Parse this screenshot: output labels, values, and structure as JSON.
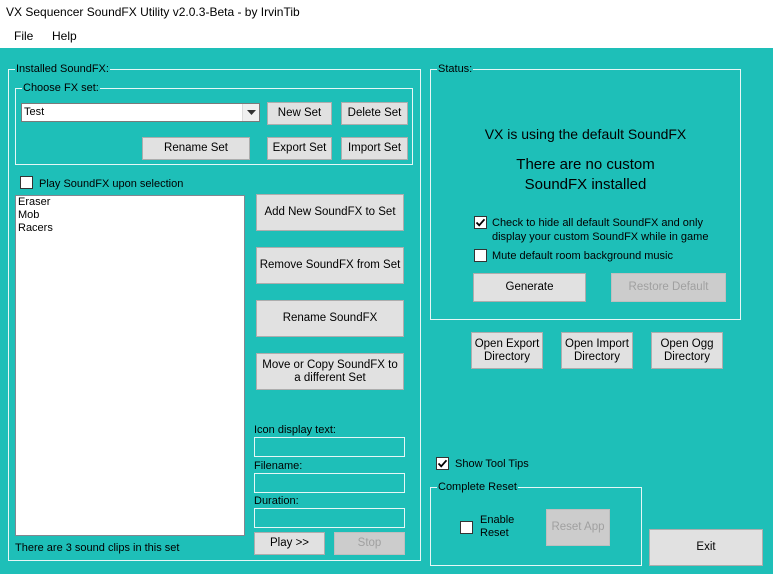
{
  "window": {
    "title": "VX Sequencer SoundFX Utility v2.0.3-Beta - by IrvinTib"
  },
  "menu": {
    "file": "File",
    "help": "Help"
  },
  "installed": {
    "group_title": "Installed SoundFX:",
    "choose_title": "Choose FX set:",
    "fx_set_value": "Test",
    "new_set": "New Set",
    "delete_set": "Delete Set",
    "rename_set": "Rename Set",
    "export_set": "Export Set",
    "import_set": "Import Set",
    "play_on_select_label": "Play SoundFX upon selection",
    "play_on_select_checked": false,
    "items": [
      "Eraser",
      "Mob",
      "Racers"
    ],
    "add_new": "Add New SoundFX to Set",
    "remove": "Remove SoundFX from Set",
    "rename": "Rename SoundFX",
    "move_copy": "Move or Copy SoundFX to\na different Set",
    "icon_text_label": "Icon display text:",
    "icon_text_value": "",
    "filename_label": "Filename:",
    "filename_value": "",
    "duration_label": "Duration:",
    "duration_value": "",
    "count_text": "There are 3 sound clips in this set",
    "play": "Play >>",
    "stop": "Stop"
  },
  "status": {
    "group_title": "Status:",
    "line1": "VX is using the default SoundFX",
    "line2": "There are no custom",
    "line3": "SoundFX installed",
    "hide_default_label": "Check to hide all default SoundFX and only\ndisplay your custom SoundFX while in game",
    "hide_default_checked": true,
    "mute_label": "Mute default room background music",
    "mute_checked": false,
    "generate": "Generate",
    "restore_default": "Restore Default"
  },
  "dirs": {
    "open_export": "Open Export\nDirectory",
    "open_import": "Open Import\nDirectory",
    "open_ogg": "Open Ogg\nDirectory"
  },
  "tooltips": {
    "label": "Show Tool Tips",
    "checked": true
  },
  "reset": {
    "group_title": "Complete Reset",
    "enable_label": "Enable\nReset",
    "enable_checked": false,
    "reset_app": "Reset App"
  },
  "exit": "Exit"
}
